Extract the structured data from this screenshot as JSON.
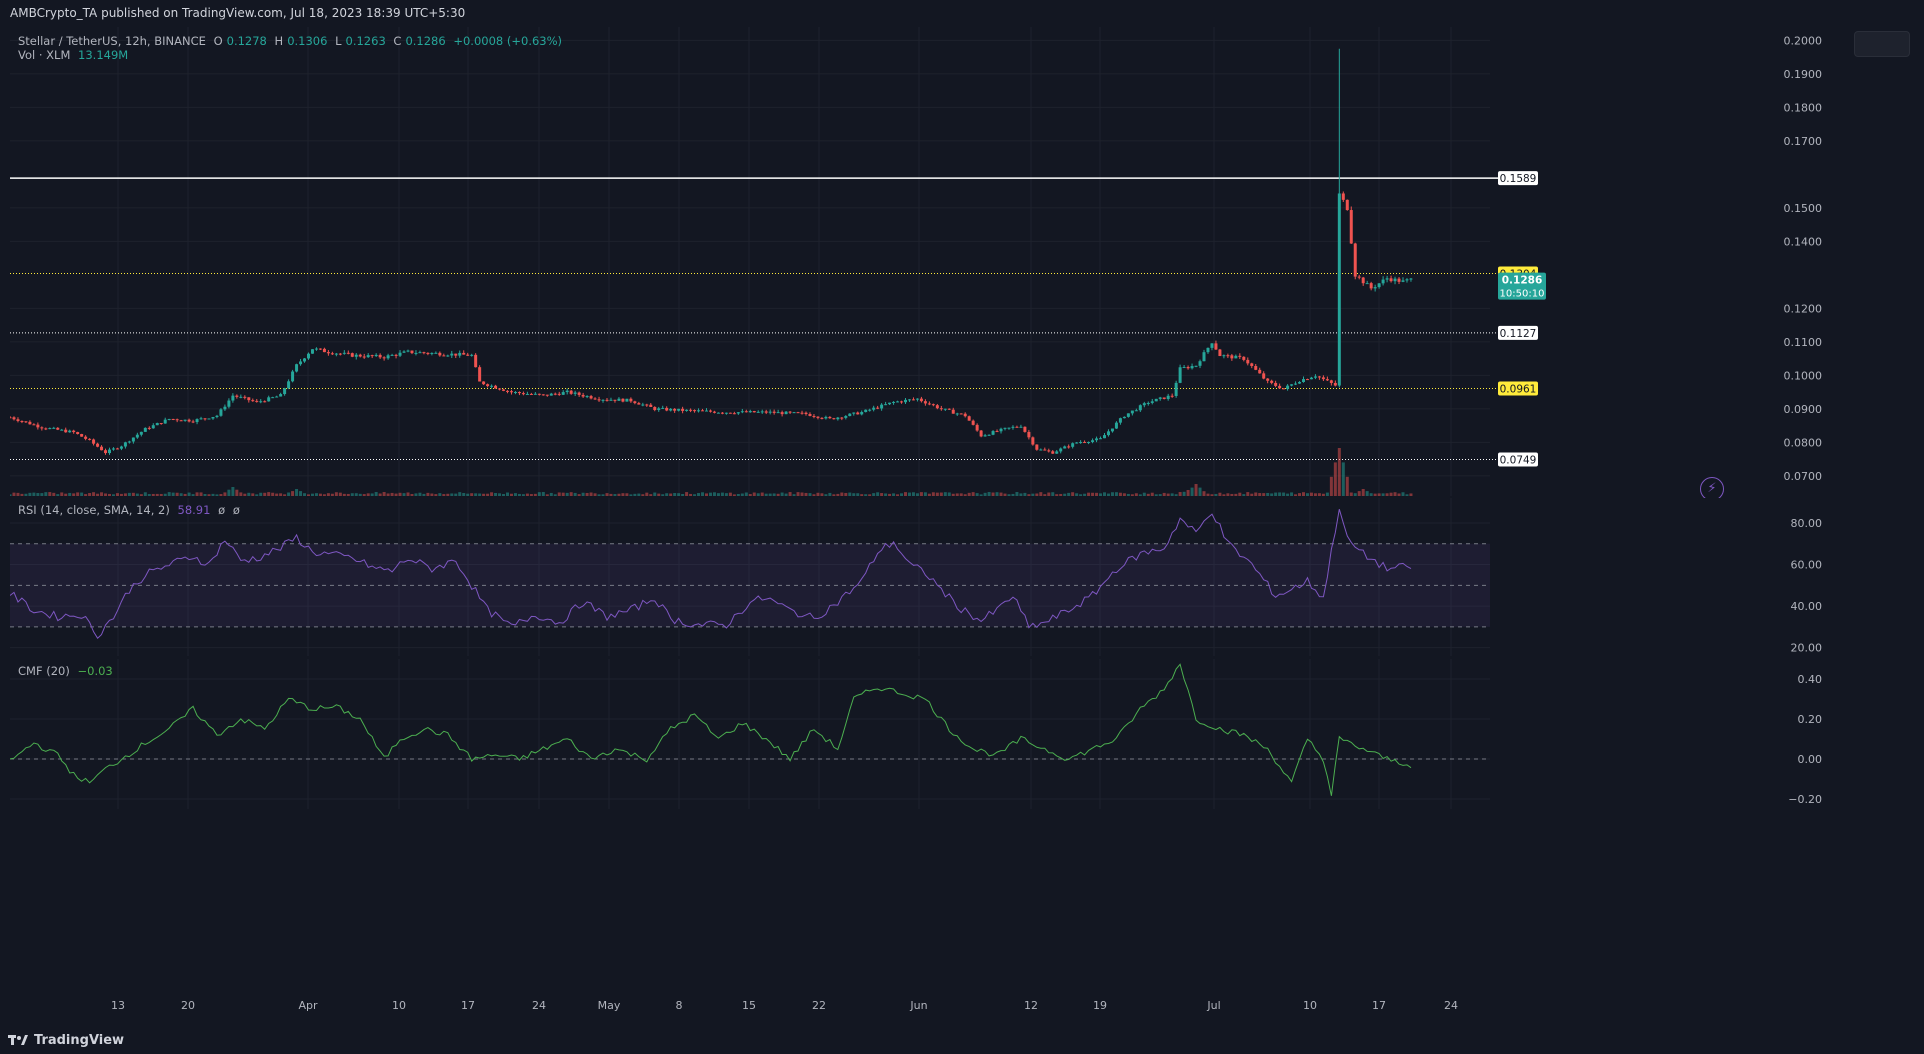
{
  "header": {
    "published": "AMBCrypto_TA published on TradingView.com, Jul 18, 2023 18:39 UTC+5:30"
  },
  "main_legend": {
    "symbol": "Stellar / TetherUS, 12h, BINANCE",
    "o_label": "O",
    "o_value": "0.1278",
    "h_label": "H",
    "h_value": "0.1306",
    "l_label": "L",
    "l_value": "0.1263",
    "c_label": "C",
    "c_value": "0.1286",
    "change": "+0.0008 (+0.63%)",
    "vol_label": "Vol · XLM",
    "vol_value": "13.149M"
  },
  "rsi_legend": {
    "label": "RSI (14, close, SMA, 14, 2)",
    "value": "58.91",
    "na1": "ø",
    "na2": "ø"
  },
  "cmf_legend": {
    "label": "CMF (20)",
    "value": "−0.03"
  },
  "brand": "TradingView",
  "colors": {
    "background": "#131722",
    "up": "#26a69a",
    "down": "#ef5350",
    "rsi_line": "#7e57c2",
    "cmf_line": "#4caf50",
    "level_yellow": "#ffeb3b",
    "level_white": "#ffffff"
  },
  "chart_data": [
    {
      "type": "candlestick",
      "name": "price",
      "x_ticks": [
        "13",
        "20",
        "Apr",
        "10",
        "17",
        "24",
        "May",
        "8",
        "15",
        "22",
        "Jun",
        "12",
        "19",
        "Jul",
        "10",
        "17",
        "24"
      ],
      "ylim": [
        0.064,
        0.204
      ],
      "y_ticks": [
        "0.2000",
        "0.1900",
        "0.1800",
        "0.1700",
        "0.1500",
        "0.1400",
        "0.1200",
        "0.1100",
        "0.1000",
        "0.0900",
        "0.0800",
        "0.0700"
      ],
      "levels": [
        {
          "value": 0.1589,
          "label": "0.1589",
          "style": "solid",
          "color": "#ffffff"
        },
        {
          "value": 0.1304,
          "label": "0.1304",
          "style": "dotted",
          "color": "#ffeb3b"
        },
        {
          "value": 0.1127,
          "label": "0.1127",
          "style": "dotted",
          "color": "#ffffff"
        },
        {
          "value": 0.0961,
          "label": "0.0961",
          "style": "dotted",
          "color": "#ffeb3b"
        },
        {
          "value": 0.0749,
          "label": "0.0749",
          "style": "dotted",
          "color": "#ffffff"
        }
      ],
      "last_price": {
        "value": 0.1286,
        "label": "0.1286",
        "countdown": "10:50:10"
      },
      "close_anchors": [
        [
          0,
          0.0875
        ],
        [
          8,
          0.0845
        ],
        [
          16,
          0.083
        ],
        [
          20,
          0.0805
        ],
        [
          24,
          0.077
        ],
        [
          28,
          0.079
        ],
        [
          34,
          0.084
        ],
        [
          40,
          0.087
        ],
        [
          46,
          0.0865
        ],
        [
          52,
          0.088
        ],
        [
          56,
          0.094
        ],
        [
          62,
          0.092
        ],
        [
          68,
          0.094
        ],
        [
          72,
          0.103
        ],
        [
          76,
          0.108
        ],
        [
          80,
          0.107
        ],
        [
          86,
          0.106
        ],
        [
          94,
          0.1055
        ],
        [
          100,
          0.107
        ],
        [
          108,
          0.1065
        ],
        [
          116,
          0.106
        ],
        [
          118,
          0.098
        ],
        [
          126,
          0.095
        ],
        [
          134,
          0.094
        ],
        [
          140,
          0.095
        ],
        [
          148,
          0.093
        ],
        [
          156,
          0.0925
        ],
        [
          162,
          0.09
        ],
        [
          170,
          0.0895
        ],
        [
          180,
          0.089
        ],
        [
          190,
          0.089
        ],
        [
          200,
          0.0885
        ],
        [
          206,
          0.087
        ],
        [
          214,
          0.089
        ],
        [
          222,
          0.092
        ],
        [
          228,
          0.093
        ],
        [
          234,
          0.09
        ],
        [
          240,
          0.088
        ],
        [
          244,
          0.082
        ],
        [
          250,
          0.084
        ],
        [
          254,
          0.085
        ],
        [
          258,
          0.078
        ],
        [
          262,
          0.077
        ],
        [
          268,
          0.08
        ],
        [
          274,
          0.081
        ],
        [
          280,
          0.088
        ],
        [
          286,
          0.092
        ],
        [
          292,
          0.094
        ],
        [
          294,
          0.102
        ],
        [
          298,
          0.103
        ],
        [
          302,
          0.11
        ],
        [
          304,
          0.106
        ],
        [
          310,
          0.105
        ],
        [
          316,
          0.098
        ],
        [
          320,
          0.096
        ],
        [
          324,
          0.0985
        ],
        [
          328,
          0.1
        ],
        [
          333,
          0.097
        ],
        [
          334,
          0.154
        ],
        [
          336,
          0.15
        ],
        [
          338,
          0.13
        ],
        [
          342,
          0.126
        ],
        [
          346,
          0.129
        ],
        [
          350,
          0.128
        ],
        [
          352,
          0.1286
        ]
      ],
      "volume_peaks": [
        [
          56,
          0.45
        ],
        [
          72,
          0.35
        ],
        [
          296,
          0.3
        ],
        [
          298,
          0.6
        ],
        [
          334,
          2.4
        ],
        [
          336,
          0.25
        ],
        [
          340,
          0.35
        ]
      ]
    },
    {
      "type": "line",
      "name": "RSI",
      "ylim": [
        16,
        92
      ],
      "y_ticks": [
        "80.00",
        "60.00",
        "40.00",
        "20.00"
      ],
      "bands": {
        "upper": 70,
        "middle": 50,
        "lower": 30
      },
      "anchors": [
        [
          0,
          46
        ],
        [
          6,
          38
        ],
        [
          12,
          35
        ],
        [
          18,
          36
        ],
        [
          22,
          26
        ],
        [
          26,
          35
        ],
        [
          30,
          48
        ],
        [
          34,
          55
        ],
        [
          40,
          60
        ],
        [
          46,
          64
        ],
        [
          50,
          60
        ],
        [
          54,
          72
        ],
        [
          58,
          62
        ],
        [
          62,
          63
        ],
        [
          68,
          68
        ],
        [
          72,
          73
        ],
        [
          76,
          66
        ],
        [
          80,
          65
        ],
        [
          86,
          63
        ],
        [
          92,
          58
        ],
        [
          96,
          57
        ],
        [
          100,
          63
        ],
        [
          106,
          58
        ],
        [
          112,
          62
        ],
        [
          116,
          50
        ],
        [
          120,
          38
        ],
        [
          126,
          30
        ],
        [
          132,
          36
        ],
        [
          138,
          32
        ],
        [
          144,
          42
        ],
        [
          150,
          35
        ],
        [
          156,
          38
        ],
        [
          162,
          44
        ],
        [
          166,
          34
        ],
        [
          172,
          31
        ],
        [
          180,
          31
        ],
        [
          186,
          42
        ],
        [
          190,
          44
        ],
        [
          196,
          38
        ],
        [
          202,
          34
        ],
        [
          208,
          42
        ],
        [
          214,
          52
        ],
        [
          218,
          66
        ],
        [
          222,
          71
        ],
        [
          226,
          60
        ],
        [
          230,
          56
        ],
        [
          234,
          48
        ],
        [
          238,
          40
        ],
        [
          244,
          33
        ],
        [
          248,
          38
        ],
        [
          252,
          45
        ],
        [
          256,
          30
        ],
        [
          260,
          32
        ],
        [
          266,
          38
        ],
        [
          272,
          45
        ],
        [
          278,
          58
        ],
        [
          284,
          65
        ],
        [
          290,
          68
        ],
        [
          294,
          82
        ],
        [
          298,
          75
        ],
        [
          302,
          86
        ],
        [
          306,
          70
        ],
        [
          312,
          60
        ],
        [
          318,
          45
        ],
        [
          322,
          48
        ],
        [
          326,
          52
        ],
        [
          330,
          44
        ],
        [
          334,
          88
        ],
        [
          336,
          72
        ],
        [
          340,
          65
        ],
        [
          346,
          58
        ],
        [
          352,
          59
        ]
      ]
    },
    {
      "type": "line",
      "name": "CMF",
      "ylim": [
        -0.25,
        0.5
      ],
      "y_ticks": [
        "0.40",
        "0.20",
        "0.00",
        "−0.20"
      ],
      "zero_line": 0,
      "anchors": [
        [
          0,
          -0.01
        ],
        [
          6,
          0.08
        ],
        [
          12,
          0.02
        ],
        [
          16,
          -0.08
        ],
        [
          20,
          -0.12
        ],
        [
          24,
          -0.05
        ],
        [
          28,
          0.0
        ],
        [
          34,
          0.08
        ],
        [
          40,
          0.15
        ],
        [
          46,
          0.25
        ],
        [
          52,
          0.12
        ],
        [
          58,
          0.2
        ],
        [
          64,
          0.15
        ],
        [
          70,
          0.3
        ],
        [
          76,
          0.25
        ],
        [
          82,
          0.26
        ],
        [
          88,
          0.2
        ],
        [
          94,
          0.0
        ],
        [
          98,
          0.1
        ],
        [
          104,
          0.15
        ],
        [
          110,
          0.12
        ],
        [
          116,
          0.0
        ],
        [
          122,
          0.02
        ],
        [
          128,
          0.0
        ],
        [
          134,
          0.05
        ],
        [
          140,
          0.1
        ],
        [
          146,
          0.0
        ],
        [
          152,
          0.05
        ],
        [
          160,
          0.0
        ],
        [
          166,
          0.15
        ],
        [
          172,
          0.22
        ],
        [
          178,
          0.1
        ],
        [
          184,
          0.18
        ],
        [
          190,
          0.1
        ],
        [
          196,
          0.0
        ],
        [
          202,
          0.15
        ],
        [
          208,
          0.05
        ],
        [
          212,
          0.3
        ],
        [
          218,
          0.36
        ],
        [
          224,
          0.33
        ],
        [
          230,
          0.3
        ],
        [
          236,
          0.15
        ],
        [
          242,
          0.05
        ],
        [
          248,
          0.02
        ],
        [
          254,
          0.1
        ],
        [
          260,
          0.05
        ],
        [
          266,
          0.0
        ],
        [
          272,
          0.05
        ],
        [
          278,
          0.1
        ],
        [
          284,
          0.25
        ],
        [
          290,
          0.35
        ],
        [
          294,
          0.48
        ],
        [
          298,
          0.2
        ],
        [
          304,
          0.15
        ],
        [
          310,
          0.12
        ],
        [
          316,
          0.05
        ],
        [
          322,
          -0.12
        ],
        [
          326,
          0.1
        ],
        [
          330,
          0.0
        ],
        [
          332,
          -0.18
        ],
        [
          334,
          0.1
        ],
        [
          340,
          0.05
        ],
        [
          346,
          0.0
        ],
        [
          352,
          -0.03
        ]
      ]
    }
  ]
}
